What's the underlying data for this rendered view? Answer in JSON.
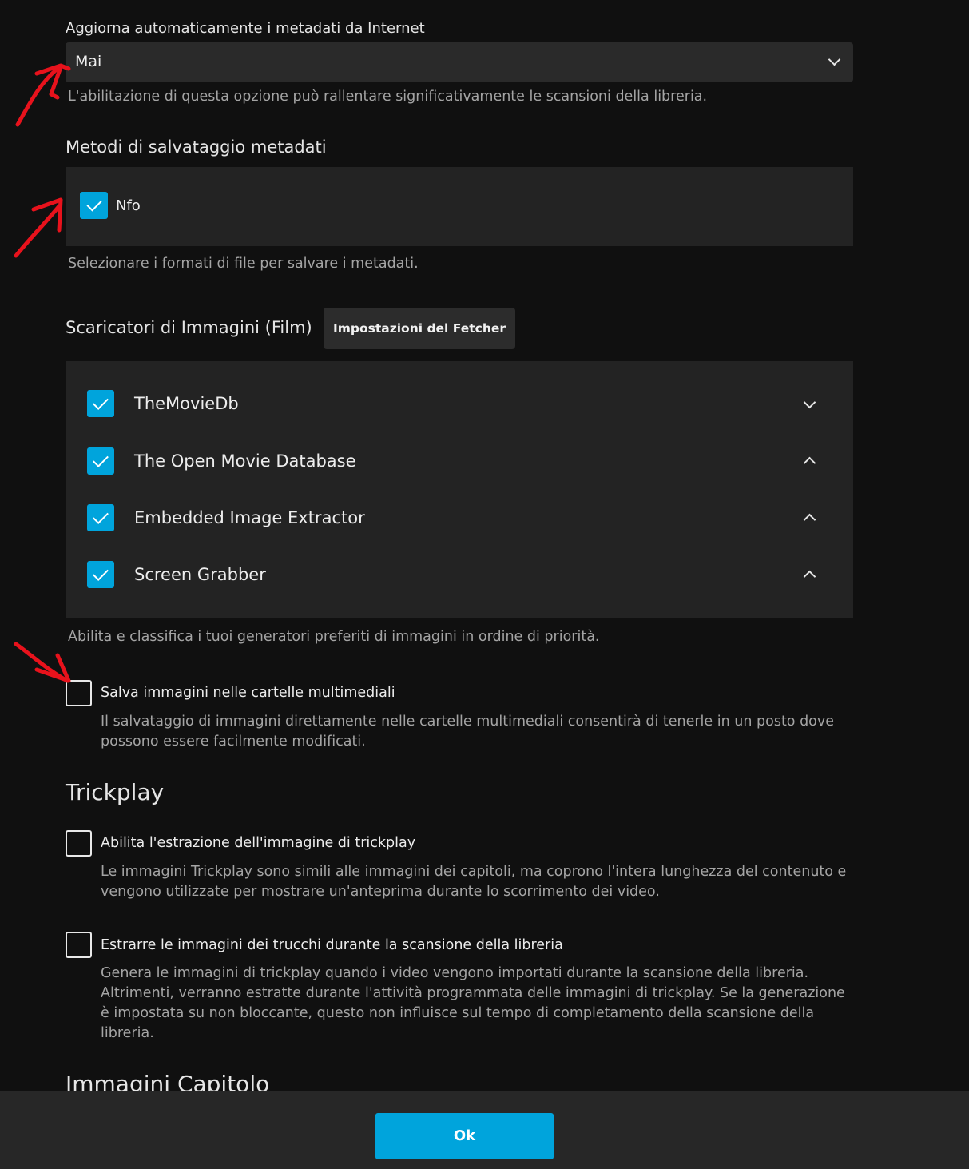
{
  "auto_refresh": {
    "label": "Aggiorna automaticamente i metadati da Internet",
    "value": "Mai",
    "help": "L'abilitazione di questa opzione può rallentare significativamente le scansioni della libreria."
  },
  "metadata_savers": {
    "title": "Metodi di salvataggio metadati",
    "items": [
      {
        "label": "Nfo",
        "checked": true
      }
    ],
    "help": "Selezionare i formati di file per salvare i metadati."
  },
  "image_fetchers": {
    "title": "Scaricatori di Immagini (Film)",
    "settings_button": "Impostazioni del Fetcher",
    "items": [
      {
        "label": "TheMovieDb",
        "checked": true,
        "chevron": "down"
      },
      {
        "label": "The Open Movie Database",
        "checked": true,
        "chevron": "up"
      },
      {
        "label": "Embedded Image Extractor",
        "checked": true,
        "chevron": "up"
      },
      {
        "label": "Screen Grabber",
        "checked": true,
        "chevron": "up"
      }
    ],
    "help": "Abilita e classifica i tuoi generatori preferiti di immagini in ordine di priorità."
  },
  "save_local": {
    "label": "Salva immagini nelle cartelle multimediali",
    "checked": false,
    "desc": "Il salvataggio di immagini direttamente nelle cartelle multimediali consentirà di tenerle in un posto dove possono essere facilmente modificati."
  },
  "trickplay": {
    "title": "Trickplay",
    "extraction": {
      "label": "Abilita l'estrazione dell'immagine di trickplay",
      "checked": false,
      "desc": "Le immagini Trickplay sono simili alle immagini dei capitoli, ma coprono l'intera lunghezza del contenuto e vengono utilizzate per mostrare un'anteprima durante lo scorrimento dei video."
    },
    "during_scan": {
      "label": "Estrarre le immagini dei trucchi durante la scansione della libreria",
      "checked": false,
      "desc": "Genera le immagini di trickplay quando i video vengono importati durante la scansione della libreria. Altrimenti, verranno estratte durante l'attività programmata delle immagini di trickplay. Se la generazione è impostata su non bloccante, questo non influisce sul tempo di completamento della scansione della libreria."
    }
  },
  "chapter_images": {
    "title": "Immagini Capitolo"
  },
  "footer": {
    "ok_label": "Ok"
  },
  "colors": {
    "accent": "#00a4dc",
    "background": "#101010",
    "panel": "#232323",
    "annotation": "#e8121c"
  }
}
